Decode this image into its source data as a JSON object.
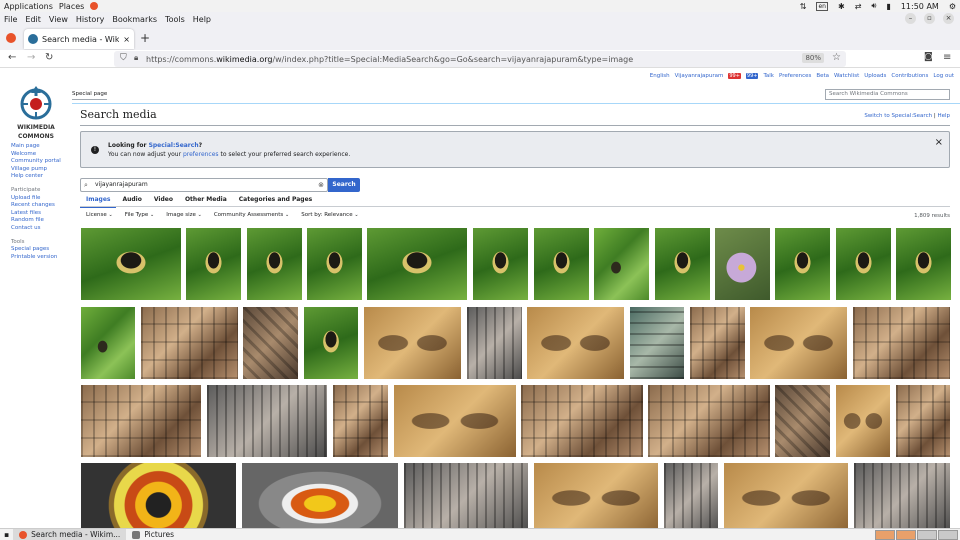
{
  "topbar": {
    "applications": "Applications",
    "places": "Places",
    "clock": "11:50 AM",
    "keyboard": "en"
  },
  "menubar": [
    "File",
    "Edit",
    "View",
    "History",
    "Bookmarks",
    "Tools",
    "Help"
  ],
  "tab": {
    "title": "Search media - Wikimedia",
    "new_tab": "+"
  },
  "navbar": {
    "url_prefix": "https://commons.",
    "url_domain": "wikimedia.org",
    "url_rest": "/w/index.php?title=Special:MediaSearch&go=Go&search=vijayanrajapuram&type=image",
    "zoom": "80%"
  },
  "wiki": {
    "logo_text_1": "WIKIMEDIA",
    "logo_text_2": "COMMONS",
    "sidebar": {
      "nav": [
        "Main page",
        "Welcome",
        "Community portal",
        "Village pump",
        "Help center"
      ],
      "participate_heading": "Participate",
      "participate": [
        "Upload file",
        "Recent changes",
        "Latest files",
        "Random file",
        "Contact us"
      ],
      "tools_heading": "Tools",
      "tools": [
        "Special pages",
        "Printable version"
      ]
    },
    "user_links": {
      "language": "English",
      "username": "Vijayanrajapuram",
      "alerts": "99+",
      "notices": "99+",
      "talk": "Talk",
      "preferences": "Preferences",
      "beta": "Beta",
      "watchlist": "Watchlist",
      "uploads": "Uploads",
      "contributions": "Contributions",
      "logout": "Log out"
    },
    "special_tab": "Special page",
    "search_placeholder": "Search Wikimedia Commons",
    "page_title": "Search media",
    "switch_link": "Switch to Special:Search",
    "help_link": "Help",
    "separator": "|",
    "notice": {
      "title_prefix": "Looking for ",
      "title_link": "Special:Search",
      "title_suffix": "?",
      "body_prefix": "You can now adjust your ",
      "body_link": "preferences",
      "body_suffix": " to select your preferred search experience.",
      "close": "×"
    },
    "search_value": "vijayanrajapuram",
    "search_button": "Search",
    "tabs": [
      "Images",
      "Audio",
      "Video",
      "Other Media",
      "Categories and Pages"
    ],
    "active_tab": "Images",
    "filters": [
      "License",
      "File Type",
      "Image size",
      "Community Assessments",
      "Sort by: Relevance"
    ],
    "result_count": "1,809 results"
  },
  "taskbar": {
    "items": [
      "Search media - Wikim...",
      "Pictures"
    ]
  }
}
